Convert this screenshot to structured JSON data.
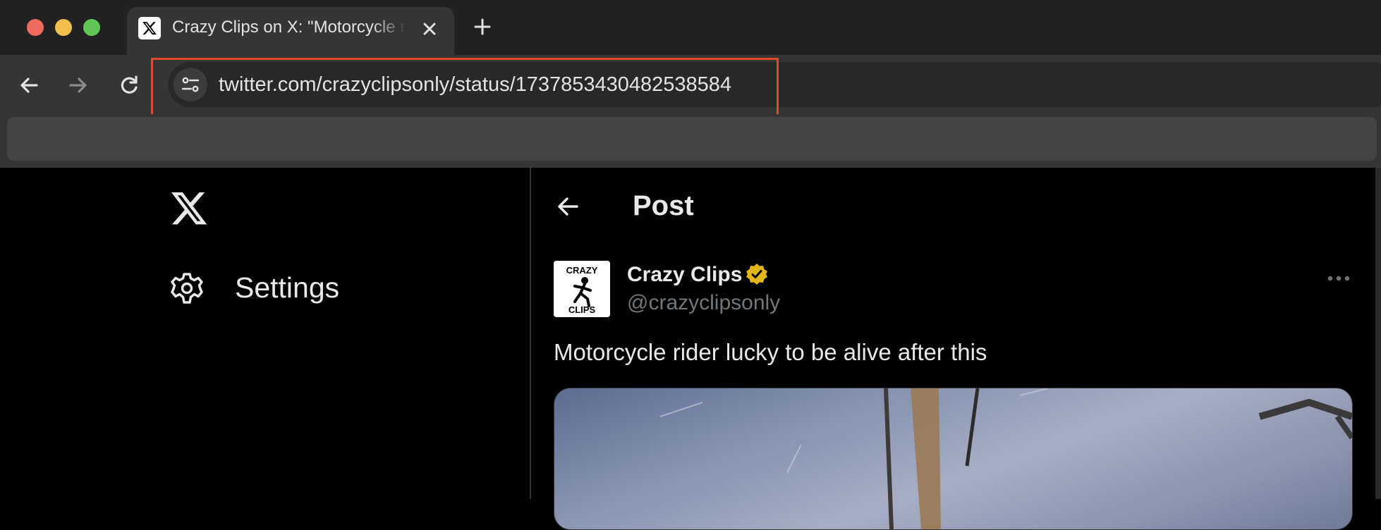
{
  "browser": {
    "traffic_lights": {
      "close": "#ed6a5e",
      "minimize": "#f5bf4f",
      "maximize": "#61c554"
    },
    "tab": {
      "title": "Crazy Clips on X: \"Motorcycle rider lucky to be alive after this\""
    },
    "address_bar": {
      "url": "twitter.com/crazyclipsonly/status/1737853430482538584"
    }
  },
  "sidebar": {
    "items": [
      {
        "icon": "gear-icon",
        "label": "Settings"
      }
    ]
  },
  "post": {
    "header_title": "Post",
    "author": {
      "name": "Crazy Clips",
      "handle": "@crazyclipsonly",
      "verified": true,
      "verified_color": "#e2b719"
    },
    "avatar_text": {
      "top": "CRAZY",
      "bottom": "CLIPS"
    },
    "text": "Motorcycle rider lucky to be alive after this"
  },
  "colors": {
    "accent_highlight": "#e0492a",
    "page_bg": "#000000",
    "text_primary": "#e7e9ea",
    "text_secondary": "#71767b"
  }
}
